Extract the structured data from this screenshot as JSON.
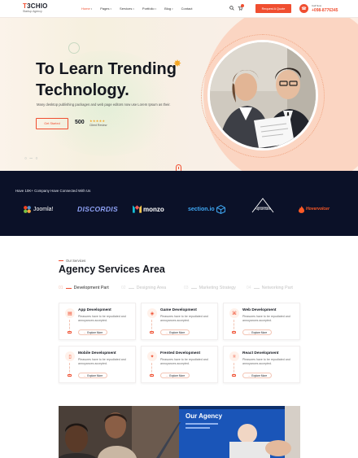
{
  "header": {
    "logo_prefix": "T",
    "logo_rest": "3CHIO",
    "logo_tagline": "Startup Agency",
    "nav": [
      {
        "label": "Home",
        "active": true
      },
      {
        "label": "Pages"
      },
      {
        "label": "Services"
      },
      {
        "label": "Portfolio"
      },
      {
        "label": "Blog"
      },
      {
        "label": "Contact"
      }
    ],
    "quote_button": "Request A Quote",
    "call_label": "Call Now",
    "phone": "+098-8776345",
    "search_icon": "search-icon",
    "cart_icon": "cart-icon",
    "phone_icon": "phone-icon"
  },
  "hero": {
    "title_line1": "To Learn Trending",
    "title_line2": "Technology.",
    "description": "Many desktop publishing packages and web page editors now use Lorem Ipsum as their.",
    "cta": "Get Started",
    "review_count": "500",
    "review_stars": "★★★★★",
    "review_label": "Client Review"
  },
  "brands": {
    "title": "Have 10K+ Company Have Connected With Us",
    "items": [
      "Joomla!",
      "DISCORDIS",
      "monzo",
      "section.io",
      "Aquastate",
      "Hovervolcer"
    ]
  },
  "services": {
    "subtitle": "Our Services",
    "title": "Agency Services Area",
    "tabs": [
      {
        "num": "01",
        "label": "Development Part",
        "active": true
      },
      {
        "num": "02",
        "label": "Designing Area"
      },
      {
        "num": "03",
        "label": "Marketing Strategy"
      },
      {
        "num": "04",
        "label": "Networking Part"
      }
    ],
    "cards": [
      {
        "title": "App Development",
        "desc": "Pleasures have to be repudiated and annoyances accepted.",
        "button": "Explore More",
        "icon": "app-icon"
      },
      {
        "title": "Game Development",
        "desc": "Pleasures have to be repudiated and annoyances accepted.",
        "button": "Explore More",
        "icon": "game-icon"
      },
      {
        "title": "Web Development",
        "desc": "Pleasures have to be repudiated and annoyances accepted.",
        "button": "Explore More",
        "icon": "web-icon"
      },
      {
        "title": "Mobile Development",
        "desc": "Pleasures have to be repudiated and annoyances accepted.",
        "button": "Explore More",
        "icon": "mobile-icon"
      },
      {
        "title": "Frented Development",
        "desc": "Pleasures have to be repudiated and annoyances accepted.",
        "button": "Explore More",
        "icon": "frontend-icon"
      },
      {
        "title": "React Development",
        "desc": "Pleasures have to be repudiated and annoyances accepted.",
        "button": "Explore More",
        "icon": "react-icon"
      }
    ]
  },
  "agency_photo": {
    "screen_text": "Our Agency"
  },
  "colors": {
    "accent": "#f04e30",
    "dark_band": "#0b1128",
    "hero_peach": "#fbd5c2"
  }
}
